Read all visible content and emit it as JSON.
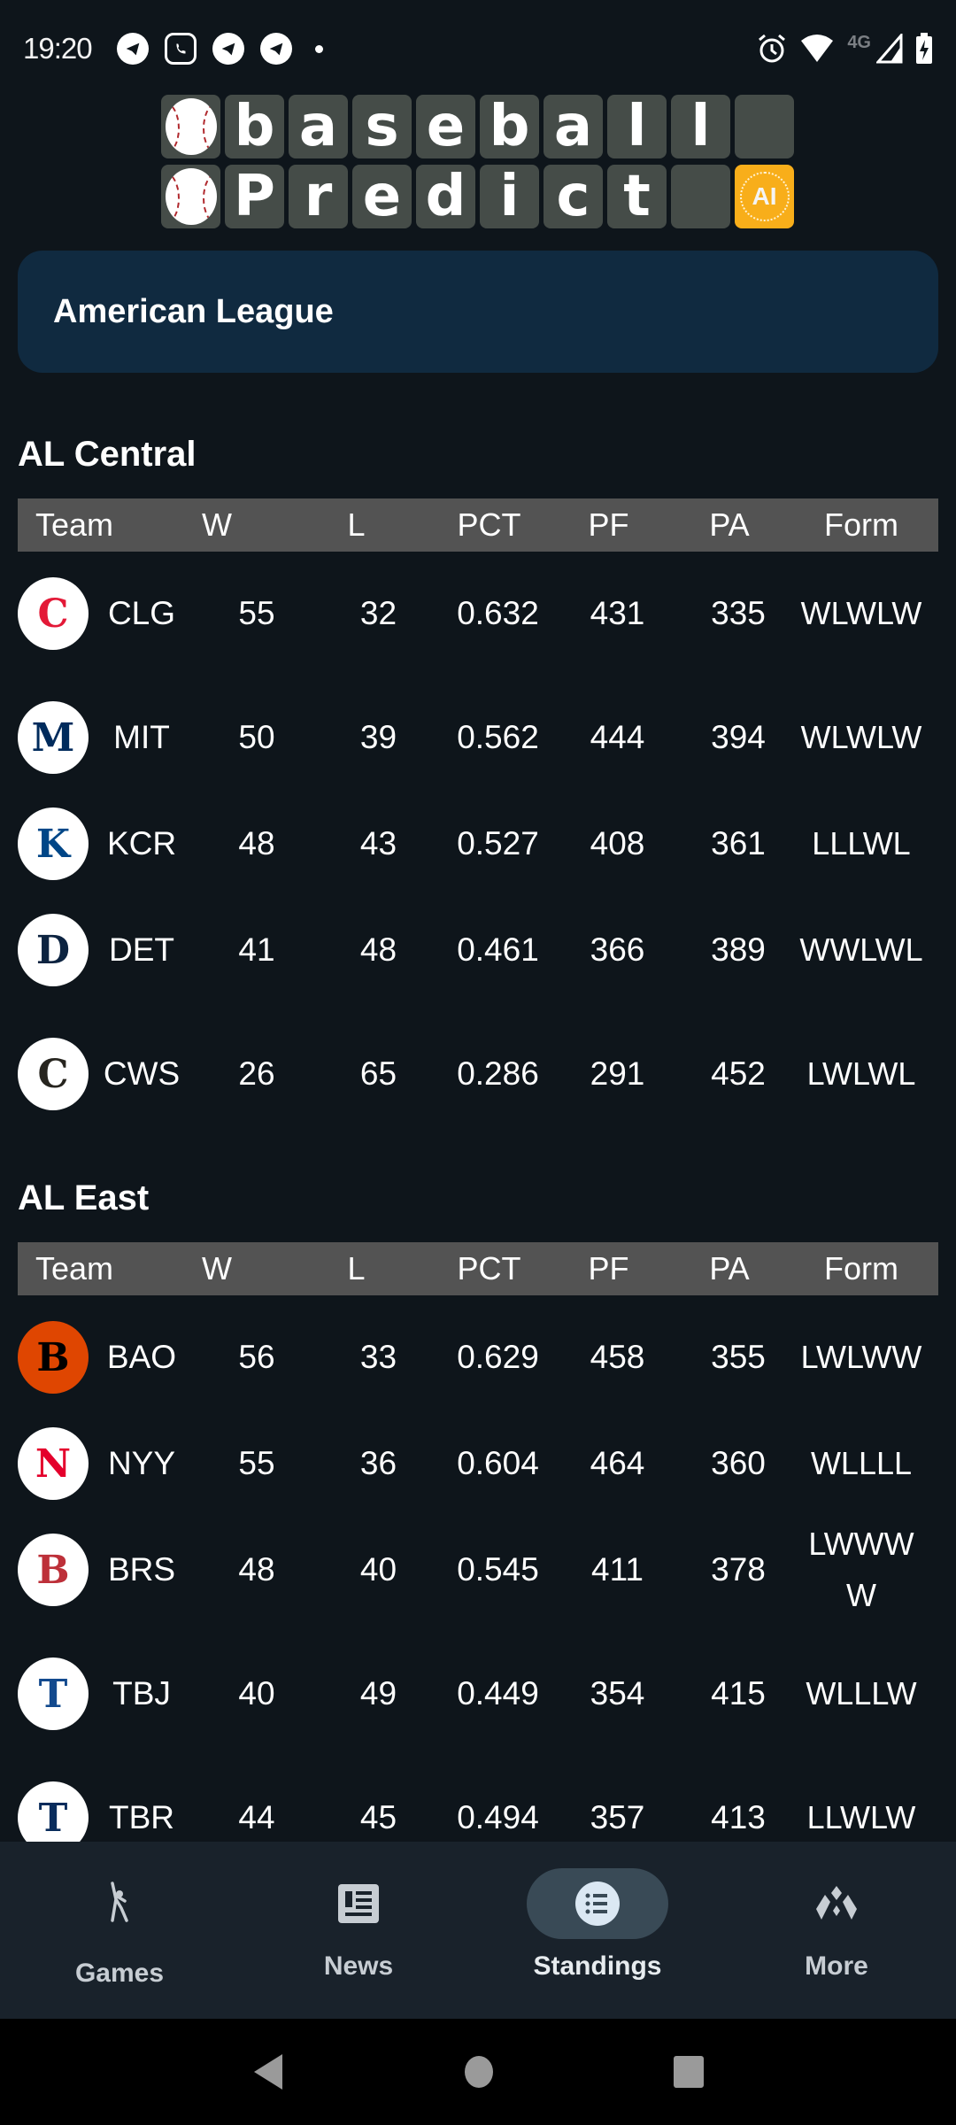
{
  "status_bar": {
    "time": "19:20",
    "notifications": [
      "telegram-icon",
      "viber-icon",
      "telegram-icon",
      "telegram-icon"
    ],
    "network": "4G"
  },
  "logo": {
    "row1": [
      "b",
      "a",
      "s",
      "e",
      "b",
      "a",
      "l",
      "l",
      ""
    ],
    "row2": [
      "P",
      "r",
      "e",
      "d",
      "i",
      "c",
      "t",
      ""
    ],
    "badge": "AI"
  },
  "league": {
    "title": "American League"
  },
  "columns": [
    "Team",
    "W",
    "L",
    "PCT",
    "PF",
    "PA",
    "Form"
  ],
  "divisions": [
    {
      "title": "AL Central",
      "teams": [
        {
          "abbr": "CLG",
          "w": "55",
          "l": "32",
          "pct": "0.632",
          "pf": "431",
          "pa": "335",
          "form": "WLWLW",
          "logo": "guardians-logo",
          "logo_color": "#e31937"
        },
        {
          "abbr": "MIT",
          "w": "50",
          "l": "39",
          "pct": "0.562",
          "pf": "444",
          "pa": "394",
          "form": "WLWLW",
          "logo": "twins-logo",
          "logo_color": "#002b5c"
        },
        {
          "abbr": "KCR",
          "w": "48",
          "l": "43",
          "pct": "0.527",
          "pf": "408",
          "pa": "361",
          "form": "LLLWL",
          "logo": "royals-logo",
          "logo_color": "#004687"
        },
        {
          "abbr": "DET",
          "w": "41",
          "l": "48",
          "pct": "0.461",
          "pf": "366",
          "pa": "389",
          "form": "WWLWL",
          "logo": "tigers-logo",
          "logo_color": "#0c2340"
        },
        {
          "abbr": "CWS",
          "w": "26",
          "l": "65",
          "pct": "0.286",
          "pf": "291",
          "pa": "452",
          "form": "LWLWL",
          "logo": "white-sox-logo",
          "logo_color": "#27251f"
        }
      ]
    },
    {
      "title": "AL East",
      "teams": [
        {
          "abbr": "BAO",
          "w": "56",
          "l": "33",
          "pct": "0.629",
          "pf": "458",
          "pa": "355",
          "form": "LWLWW",
          "logo": "orioles-logo",
          "logo_color": "#df4601"
        },
        {
          "abbr": "NYY",
          "w": "55",
          "l": "36",
          "pct": "0.604",
          "pf": "464",
          "pa": "360",
          "form": "WLLLL",
          "logo": "yankees-logo",
          "logo_color": "#e4002c"
        },
        {
          "abbr": "BRS",
          "w": "48",
          "l": "40",
          "pct": "0.545",
          "pf": "411",
          "pa": "378",
          "form": "LWWWW",
          "logo": "red-sox-logo",
          "logo_color": "#bd3039"
        },
        {
          "abbr": "TBJ",
          "w": "40",
          "l": "49",
          "pct": "0.449",
          "pf": "354",
          "pa": "415",
          "form": "WLLLW",
          "logo": "blue-jays-logo",
          "logo_color": "#134a8e"
        },
        {
          "abbr": "TBR",
          "w": "44",
          "l": "45",
          "pct": "0.494",
          "pf": "357",
          "pa": "413",
          "form": "LLWLW",
          "logo": "rays-logo",
          "logo_color": "#092c5c"
        }
      ]
    }
  ],
  "bottom_nav": {
    "items": [
      {
        "label": "Games",
        "icon": "batter-icon",
        "active": false
      },
      {
        "label": "News",
        "icon": "newspaper-icon",
        "active": false
      },
      {
        "label": "Standings",
        "icon": "list-icon",
        "active": true
      },
      {
        "label": "More",
        "icon": "more-diamonds-icon",
        "active": false
      }
    ]
  },
  "colors": {
    "background": "#0e151b",
    "banner": "#102a40",
    "table_header": "#535353",
    "nav_bg": "#19222b",
    "nav_active_pill": "#394a56",
    "ai_badge": "#f8ae1a"
  }
}
